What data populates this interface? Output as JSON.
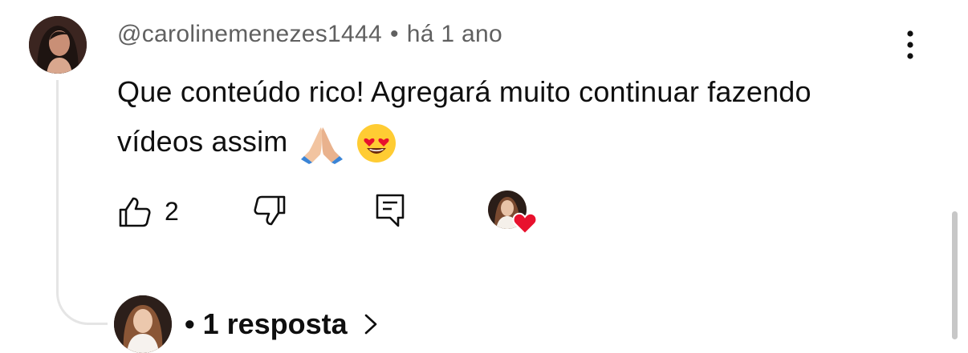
{
  "comment": {
    "author": "@carolinemenezes1444",
    "separator": "•",
    "timestamp": "há 1 ano",
    "text": "Que conteúdo rico! Agregará muito continuar fazendo vídeos assim",
    "emojis": [
      "folded-hands-emoji",
      "heart-eyes-emoji"
    ]
  },
  "actions": {
    "like_count": "2"
  },
  "replies": {
    "label": "• 1 resposta"
  },
  "colors": {
    "text": "#0f0f0f",
    "secondary": "#606060",
    "heart": "#e8112d",
    "thread_line": "#e5e5e5"
  }
}
